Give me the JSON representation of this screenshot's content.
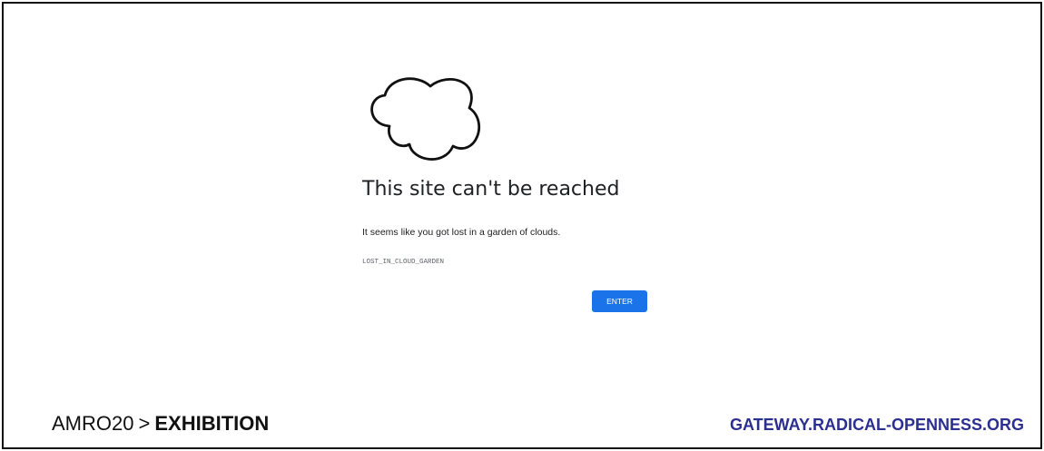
{
  "error_page": {
    "title": "This site can't be reached",
    "message": "It seems like you got lost in a garden of clouds.",
    "error_code": "LOST_IN_CLOUD_GARDEN",
    "button_label": "ENTER",
    "icon": "cloud-outline-icon"
  },
  "caption": {
    "breadcrumb_root": "AMRO20",
    "breadcrumb_separator": ">",
    "breadcrumb_current": "EXHIBITION",
    "site_url": "GATEWAY.RADICAL-OPENNESS.ORG"
  },
  "colors": {
    "button": "#1a73e8",
    "url_text": "#2b2f8f",
    "frame_border": "#111111"
  }
}
